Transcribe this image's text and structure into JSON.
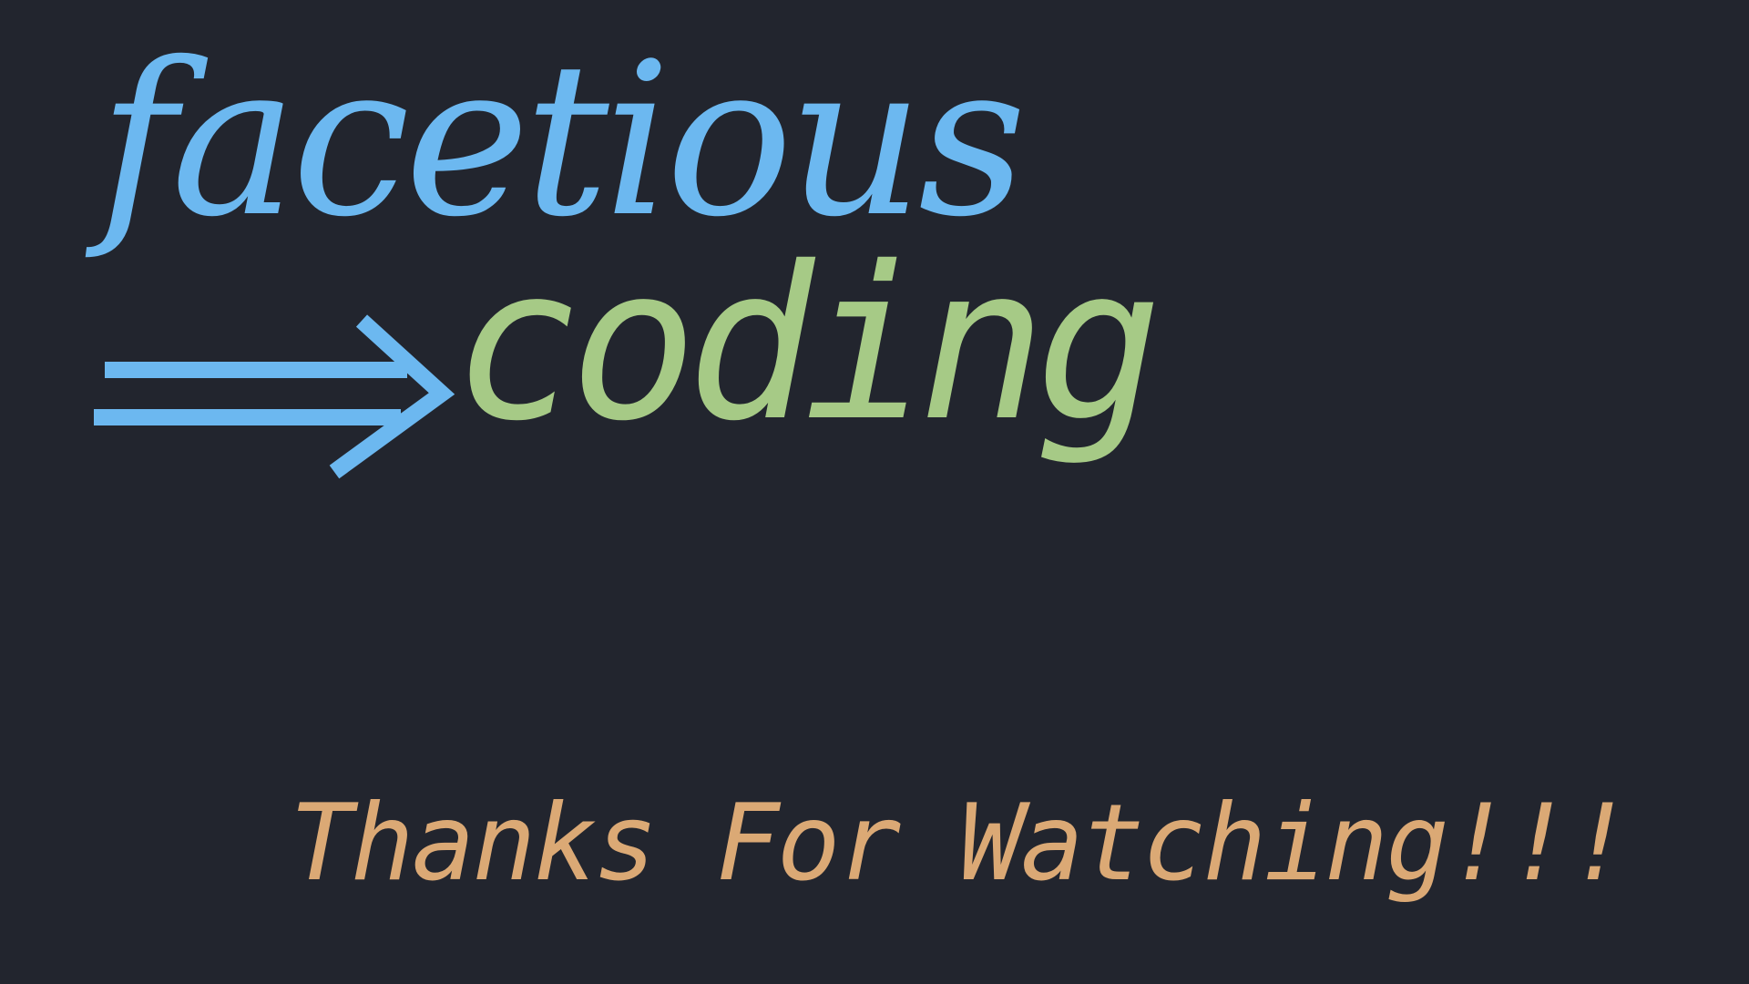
{
  "title": {
    "word1": "facetious",
    "word2": "coding"
  },
  "arrow": {
    "icon": "double-arrow-right-icon"
  },
  "footer": {
    "message": "Thanks For Watching!!!"
  },
  "colors": {
    "background": "#22252e",
    "word1": "#6cb8f0",
    "arrow": "#6cb8f0",
    "word2": "#a6ca86",
    "footer": "#dba975"
  }
}
